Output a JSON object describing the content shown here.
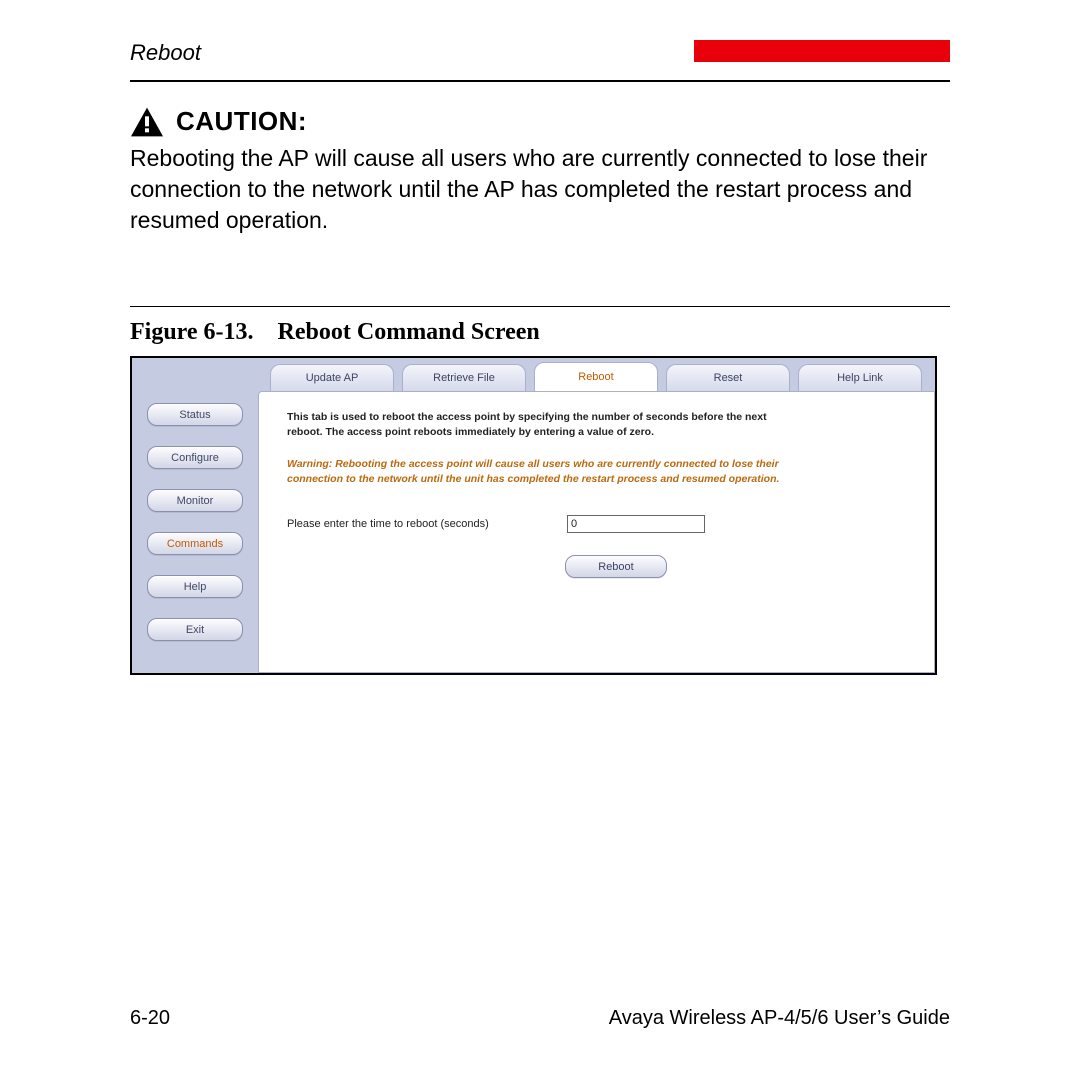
{
  "header": {
    "section_title": "Reboot"
  },
  "caution": {
    "label": "CAUTION:",
    "body": "Rebooting the AP will cause all users who are currently connected to lose their connection to the network until the AP has completed the restart process and resumed operation."
  },
  "figure": {
    "caption": "Figure 6-13. Reboot Command Screen"
  },
  "screenshot": {
    "sidebar": {
      "items": [
        {
          "label": "Status",
          "active": false
        },
        {
          "label": "Configure",
          "active": false
        },
        {
          "label": "Monitor",
          "active": false
        },
        {
          "label": "Commands",
          "active": true
        },
        {
          "label": "Help",
          "active": false
        },
        {
          "label": "Exit",
          "active": false
        }
      ]
    },
    "tabs": [
      {
        "label": "Update AP",
        "active": false
      },
      {
        "label": "Retrieve File",
        "active": false
      },
      {
        "label": "Reboot",
        "active": true
      },
      {
        "label": "Reset",
        "active": false
      },
      {
        "label": "Help Link",
        "active": false
      }
    ],
    "panel": {
      "desc": "This tab is used to reboot the access point by specifying the number of seconds before the next reboot. The access point reboots immediately by entering a value of zero.",
      "warn": "Warning: Rebooting the access point will cause all users who are currently connected to lose their connection to the network until the unit has completed the restart process and resumed operation.",
      "input_label": "Please enter the time to reboot (seconds)",
      "input_value": "0",
      "button_label": "Reboot"
    }
  },
  "footer": {
    "page_number": "6-20",
    "doc_title": "Avaya Wireless AP-4/5/6 User’s Guide"
  }
}
